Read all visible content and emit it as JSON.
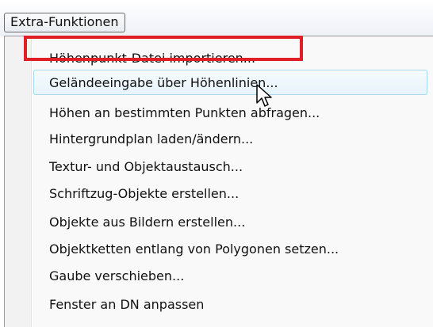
{
  "menubar": {
    "menu_label": "Extra-Funktionen"
  },
  "menu": {
    "items": [
      {
        "label": "Höhenpunkt-Datei importieren..."
      },
      {
        "label": "Geländeeingabe über Höhenlinien..."
      },
      {
        "label": "Höhen an bestimmten Punkten abfragen..."
      },
      {
        "label": "Hintergrundplan laden/ändern..."
      },
      {
        "label": "Textur- und Objektaustausch..."
      },
      {
        "label": "Schriftzug-Objekte erstellen..."
      },
      {
        "label": "Objekte aus Bildern erstellen..."
      },
      {
        "label": "Objektketten entlang von Polygonen setzen..."
      },
      {
        "label": "Gaube verschieben..."
      },
      {
        "label": "Fenster an DN anpassen"
      }
    ],
    "hovered_index": 1
  },
  "colors": {
    "highlight_box": "#e01e25",
    "hover_border": "#a8d8f0"
  },
  "icons": {
    "cursor": "mouse-pointer-icon"
  }
}
